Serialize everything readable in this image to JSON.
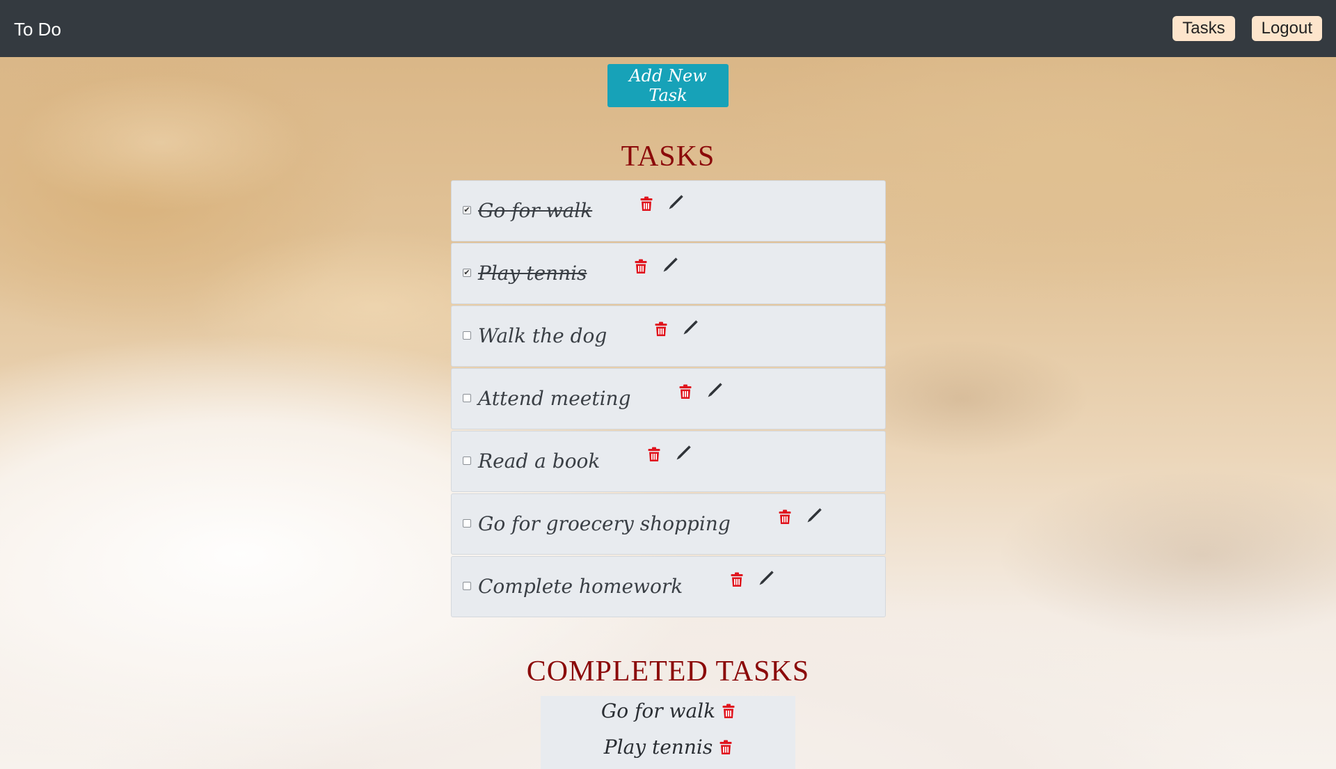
{
  "navbar": {
    "brand": "To Do",
    "tasks_label": "Tasks",
    "logout_label": "Logout"
  },
  "add_task_label": "Add New Task",
  "tasks_title": "TASKS",
  "tasks": [
    {
      "label": "Go for walk",
      "checked": true
    },
    {
      "label": "Play tennis",
      "checked": true
    },
    {
      "label": "Walk the dog",
      "checked": false
    },
    {
      "label": "Attend meeting",
      "checked": false
    },
    {
      "label": "Read a book",
      "checked": false
    },
    {
      "label": "Go for groecery shopping",
      "checked": false
    },
    {
      "label": "Complete homework",
      "checked": false
    }
  ],
  "completed_title": "COMPLETED TASKS",
  "completed": [
    {
      "label": "Go for walk"
    },
    {
      "label": "Play tennis"
    }
  ],
  "icons": {
    "delete": "trash-icon",
    "edit": "pencil-icon"
  },
  "colors": {
    "navbar": "#343a40",
    "nav_button": "#fde5cc",
    "add_button": "#17a2b8",
    "title": "#8b0a0a",
    "delete_icon": "#e0141e",
    "row_bg": "#e8ebef"
  }
}
